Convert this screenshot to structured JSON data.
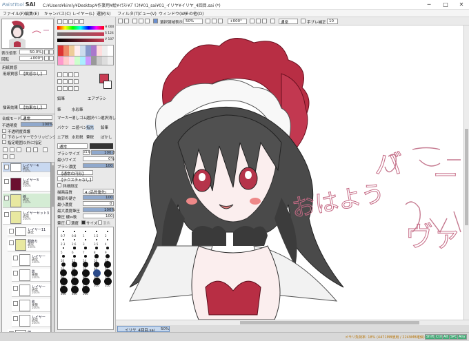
{
  "app": {
    "logo_prefix": "PaintTool",
    "logo_name": "SAI",
    "title": "C:¥Users¥kimly¥Desktop¥作業用¥絵¥ｲﾗｽﾄ¥ﾌﾟﾘｺﾈ¥01_sai¥01_イリヤ¥イリヤ_4回目.sai (*)",
    "min_label": "─",
    "max_label": "□",
    "close_label": "✕"
  },
  "menu": [
    "ファイル(F)",
    "編集(E)",
    "キャンバス(C)",
    "レイヤー(L)",
    "選択(S)",
    "フィルタ(T)",
    "ビュー(V)",
    "ウィンドウ(W)",
    "その他(O)"
  ],
  "toolbar": {
    "selection_label": "選択領域表示",
    "zoom": "50%",
    "angle": "+000°",
    "blend": "通常",
    "stabilizer_label": "手ブレ補正",
    "stabilizer": "10"
  },
  "navigator": {
    "zoom_label": "表示倍率",
    "zoom": "50.0%",
    "angle_label": "回転",
    "angle": "+000°"
  },
  "paper": {
    "title": "用紙質感",
    "texture_label": "用紙質感",
    "texture": "【質感なし】",
    "effect_label": "描画効果",
    "effect": "【効果なし】"
  },
  "layer_props": {
    "mode_label": "合成モード",
    "mode": "通常",
    "opacity_label": "不透明度",
    "opacity": "100%",
    "protect_label": "不透明度保護",
    "clip_label": "下のレイヤーでクリッピング",
    "ref_label": "指定範囲以外に指定"
  },
  "layers": [
    {
      "name": "レイヤー4",
      "mode": "通常",
      "op": "100%",
      "style": "sel"
    },
    {
      "name": "レイヤー3",
      "mode": "通常",
      "op": "100%",
      "style": ""
    },
    {
      "name": "線",
      "mode": "通常",
      "op": "100%",
      "style": "grp"
    },
    {
      "name": "レイヤーセット3",
      "mode": "通常",
      "op": "100%",
      "style": ""
    },
    {
      "name": "レイヤー11",
      "mode": "通常",
      "op": "100%",
      "style": ""
    },
    {
      "name": "服飾り",
      "mode": "通常",
      "op": "100%",
      "style": ""
    },
    {
      "name": "レイヤー",
      "mode": "通常",
      "op": "100%",
      "style": ""
    },
    {
      "name": "影",
      "mode": "乗算",
      "op": "100%",
      "style": ""
    },
    {
      "name": "レイヤー",
      "mode": "通常",
      "op": "100%",
      "style": ""
    },
    {
      "name": "影",
      "mode": "乗算",
      "op": "100%",
      "style": ""
    },
    {
      "name": "レイヤー",
      "mode": "通常",
      "op": "100%",
      "style": ""
    },
    {
      "name": "線",
      "mode": "通常",
      "op": "100%",
      "style": ""
    }
  ],
  "color": {
    "h_label": "H",
    "s_label": "S",
    "v_label": "V",
    "h": "H 000",
    "s": "S 124",
    "v": "V 107",
    "main": "#c83a52"
  },
  "tools": [
    "鉛筆",
    "エアブラシ",
    "筆",
    "水彩筆",
    "マーカー",
    "消しゴム",
    "選択ペン",
    "選択消し",
    "バケツ",
    "二値ペン",
    "指先",
    "鉛筆",
    "エア鋭",
    "水彩鋭",
    "筆鋭",
    "ぼかし"
  ],
  "brush": {
    "mode": "通常",
    "size_label": "ブラシサイズ",
    "size_mul": "x1.0",
    "size": "100.0",
    "minsize_label": "最小サイズ",
    "minsize": "0%",
    "density_label": "ブラシ濃度",
    "density": "100",
    "shape": "【通常の円形】",
    "tex": "【テクスチャなし】",
    "adv_label": "詳細設定",
    "quality_label": "描画品質",
    "quality": "4 (品質優先)",
    "edge_label": "輪郭の硬さ",
    "edge": "100",
    "mindens_label": "最小濃度",
    "mindens": "0",
    "maxpress_label": "最大濃度筆圧",
    "maxpress": "100%",
    "press_label": "筆圧 硬⇔軟",
    "press": "100",
    "pressure_label": "筆圧:",
    "pressure_dens": "濃度",
    "pressure_size": "サイズ",
    "pressure_blend": "混色",
    "sizes_small": [
      "0.7",
      "0.8",
      "1",
      "1.5",
      "2",
      "2.3",
      "2.6",
      "3",
      "3.5",
      "4",
      "5",
      "6",
      "7",
      "8"
    ],
    "sizes_big": [
      "9",
      "10",
      "12",
      "14",
      "16",
      "20",
      "25",
      "30",
      "35",
      "40",
      "50",
      "60",
      "70",
      "80",
      "100",
      "120",
      "160",
      "200",
      "250",
      "300",
      "350",
      "400",
      "450",
      "500"
    ]
  },
  "tabs": [
    {
      "name": "イリヤ_4回目.sai",
      "zoom": "50%"
    }
  ],
  "status": {
    "memory": "メモリ負荷率: 18% (4471MB使用 / 2249MB確保)",
    "keys": [
      "Shift",
      "Ctrl",
      "Alt",
      "SPC",
      "Any"
    ]
  },
  "canvas_text": {
    "greeting": "おはよう",
    "right1": "バ",
    "right2": "ー",
    "right3": "ヴァ"
  }
}
